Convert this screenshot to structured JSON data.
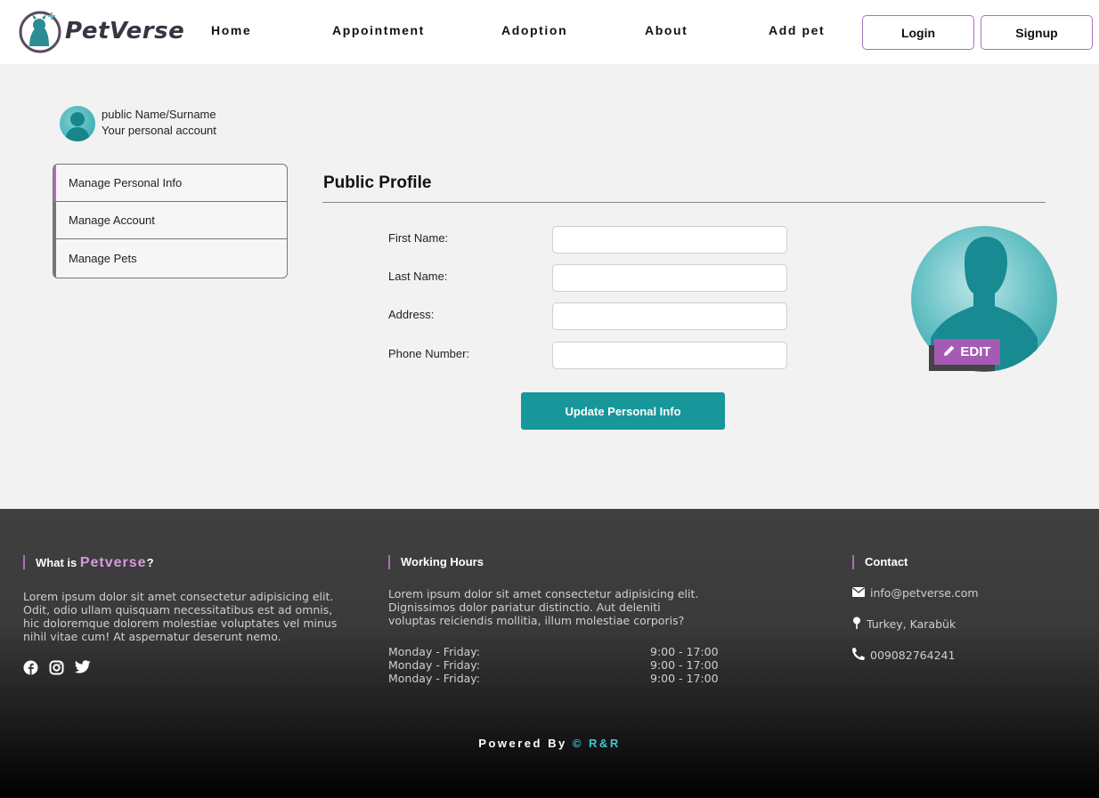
{
  "brand": {
    "name": "PetVerse"
  },
  "nav": {
    "links": [
      "Home",
      "Appointment",
      "Adoption",
      "About",
      "Add pet"
    ],
    "login": "Login",
    "signup": "Signup"
  },
  "user": {
    "name": "public Name/Surname",
    "subtitle": "Your personal account"
  },
  "sidebar": {
    "items": [
      {
        "label": "Manage Personal Info",
        "active": true
      },
      {
        "label": "Manage Account",
        "active": false
      },
      {
        "label": "Manage Pets",
        "active": false
      }
    ]
  },
  "profile": {
    "title": "Public Profile",
    "fields": [
      {
        "label": "First Name:",
        "value": "",
        "placeholder": ""
      },
      {
        "label": "Last Name:",
        "value": "",
        "placeholder": ""
      },
      {
        "label": "Address:",
        "value": "",
        "placeholder": ""
      },
      {
        "label": "Phone Number:",
        "value": "",
        "placeholder": ""
      }
    ],
    "submit": "Update Personal Info",
    "edit": "EDIT"
  },
  "footer": {
    "about": {
      "heading_prefix": "What is",
      "heading_brand": "Petverse",
      "heading_suffix": "?",
      "text": "Lorem ipsum dolor sit amet consectetur adipisicing elit. Odit, odio ullam quisquam necessitatibus est ad omnis, hic doloremque dolorem molestiae voluptates vel minus nihil vitae cum! At aspernatur deserunt nemo.",
      "socials": [
        "facebook-icon",
        "instagram-icon",
        "twitter-icon"
      ]
    },
    "hours": {
      "heading": "Working Hours",
      "text": "Lorem ipsum dolor sit amet consectetur adipisicing elit. Dignissimos dolor pariatur distinctio. Aut deleniti voluptas reiciendis mollitia, illum molestiae corporis?",
      "rows": [
        {
          "day": "Monday - Friday:",
          "time": "9:00 - 17:00"
        },
        {
          "day": "Monday - Friday:",
          "time": "9:00 - 17:00"
        },
        {
          "day": "Monday - Friday:",
          "time": "9:00 - 17:00"
        }
      ]
    },
    "contact": {
      "heading": "Contact",
      "email": "info@petverse.com",
      "location": "Turkey, Karabük",
      "phone": "009082764241"
    },
    "powered_by": "Powered By",
    "copyright_symbol": "©",
    "credit": "R&R"
  },
  "colors": {
    "accent_purple": "#a55bb3",
    "teal": "#17979a",
    "footer_dark": "#404040"
  }
}
